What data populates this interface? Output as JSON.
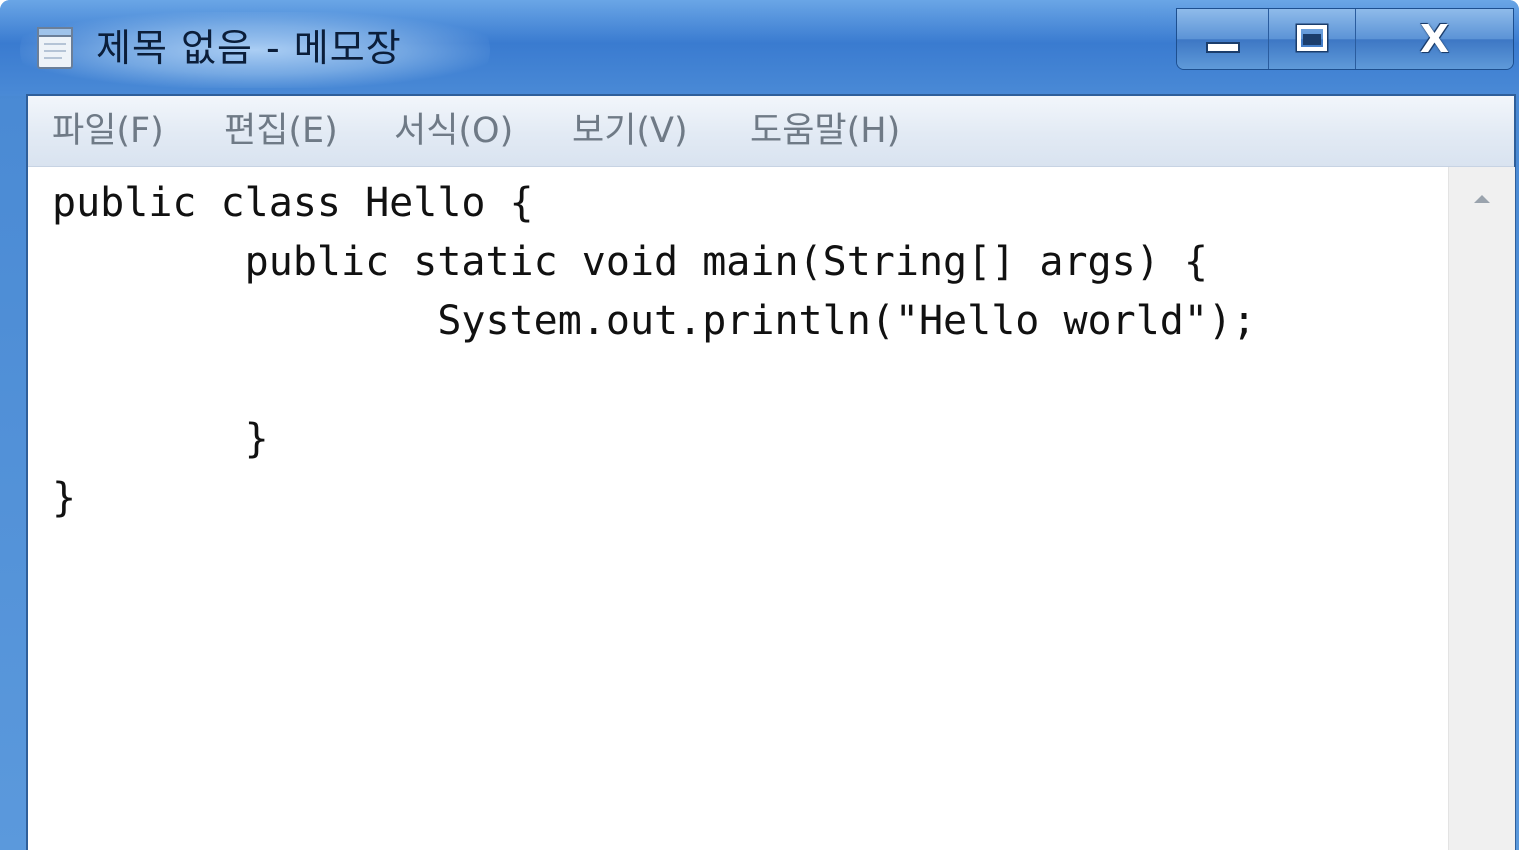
{
  "window": {
    "title": "제목 없음 - 메모장",
    "minimize_icon": "minimize-icon",
    "maximize_icon": "maximize-icon",
    "close_label": "X"
  },
  "menu": {
    "items": [
      {
        "label": "파일(F)"
      },
      {
        "label": "편집(E)"
      },
      {
        "label": "서식(O)"
      },
      {
        "label": "보기(V)"
      },
      {
        "label": "도움말(H)"
      }
    ]
  },
  "editor": {
    "lines": [
      "public class Hello {",
      "        public static void main(String[] args) {",
      "                System.out.println(\"Hello world\");",
      "",
      "        }",
      "}"
    ]
  },
  "colors": {
    "titlebar": "#3a7bd0",
    "menubar": "#e2eaf4",
    "menu_text": "#6f7a86",
    "text": "#111111"
  }
}
